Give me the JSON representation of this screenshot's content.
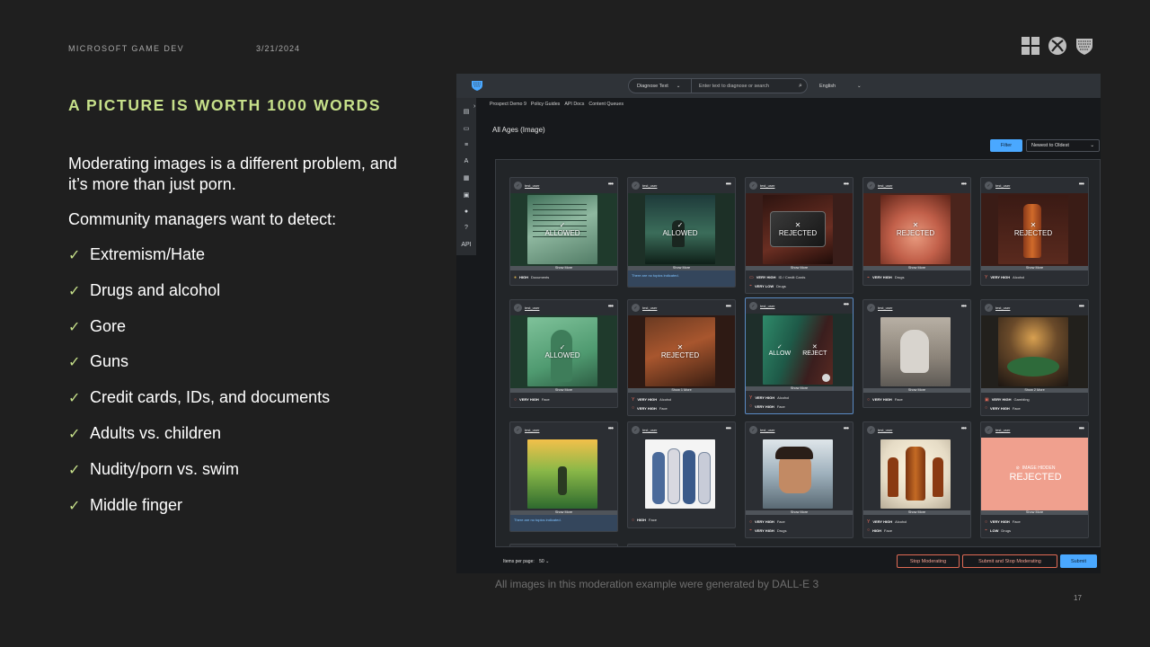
{
  "slide": {
    "org": "MICROSOFT GAME DEV",
    "date": "3/21/2024",
    "title": "A PICTURE IS WORTH 1000 WORDS",
    "intro": "Moderating images is a different problem, and it’s more than just porn.",
    "lead": "Community managers want to detect:",
    "bullets": [
      "Extremism/Hate",
      "Drugs and alcohol",
      "Gore",
      "Guns",
      "Credit cards, IDs, and documents",
      "Adults vs. children",
      "Nudity/porn vs. swim",
      "Middle finger"
    ],
    "footnote": "All images in this moderation example were generated by DALL-E 3",
    "page_number": "17",
    "check_glyph": "✓",
    "logo_icons": [
      "windows-logo-icon",
      "xbox-logo-icon",
      "community-sift-logo-icon"
    ],
    "accent_color": "#c6e08a"
  },
  "app": {
    "diagnose_select": "Diagnose Text",
    "diagnose_placeholder": "Enter text to diagnose or search",
    "language": "English",
    "breadcrumbs": [
      "Prospect Demo 9",
      "Policy Guides",
      "API Docs",
      "Content Queues"
    ],
    "page_title": "All Ages (Image)",
    "filter_label": "Filter",
    "sort_label": "Newest to Oldest",
    "sidebar_api_label": "API",
    "items_per_page_label": "Items per page:",
    "items_per_page_value": "50",
    "stop_label": "Stop Moderating",
    "submit_stop_label": "Submit and Stop Moderating",
    "submit_label": "Submit",
    "primary_color": "#4aa8ff",
    "danger_color": "#e06b55",
    "cards": [
      {
        "user": "test_user",
        "status": "ALLOWED",
        "show_more": "Show More",
        "tags": [
          {
            "level": "HIGH",
            "label": "Documents"
          }
        ]
      },
      {
        "user": "test_user",
        "status": "ALLOWED",
        "show_more": "Show More",
        "no_topics": "There are no topics indicated."
      },
      {
        "user": "test_user",
        "status": "REJECTED",
        "show_more": "Show More",
        "tags": [
          {
            "level": "VERY HIGH",
            "label": "ID / Credit Cards"
          },
          {
            "level": "VERY LOW",
            "label": "Drugs"
          }
        ]
      },
      {
        "user": "test_user",
        "status": "REJECTED",
        "show_more": "Show More",
        "tags": [
          {
            "level": "VERY HIGH",
            "label": "Drugs"
          }
        ]
      },
      {
        "user": "test_user",
        "status": "REJECTED",
        "show_more": "Show More",
        "tags": [
          {
            "level": "VERY HIGH",
            "label": "Alcohol"
          }
        ]
      },
      {
        "user": "test_user",
        "status": "ALLOWED",
        "show_more": "Show More",
        "tags": [
          {
            "level": "VERY HIGH",
            "label": "Face"
          }
        ]
      },
      {
        "user": "test_user",
        "status": "REJECTED",
        "show_more": "Show 1 More",
        "tags": [
          {
            "level": "VERY HIGH",
            "label": "Alcohol"
          },
          {
            "level": "VERY HIGH",
            "label": "Face"
          }
        ]
      },
      {
        "user": "test_user",
        "allow": "ALLOW",
        "reject": "REJECT",
        "show_more": "Show More",
        "tags": [
          {
            "level": "VERY HIGH",
            "label": "Alcohol"
          },
          {
            "level": "VERY HIGH",
            "label": "Face"
          }
        ]
      },
      {
        "user": "test_user",
        "show_more": "Show More",
        "tags": [
          {
            "level": "VERY HIGH",
            "label": "Face"
          }
        ]
      },
      {
        "user": "test_user",
        "show_more": "Show 2 More",
        "tags": [
          {
            "level": "VERY HIGH",
            "label": "Gambling"
          },
          {
            "level": "VERY HIGH",
            "label": "Face"
          }
        ]
      },
      {
        "user": "test_user",
        "show_more": "Show More",
        "no_topics": "There are no topics indicated."
      },
      {
        "user": "test_user",
        "tags": [
          {
            "level": "HIGH",
            "label": "Face"
          }
        ]
      },
      {
        "user": "test_user",
        "show_more": "Show More",
        "tags": [
          {
            "level": "VERY HIGH",
            "label": "Face"
          },
          {
            "level": "VERY HIGH",
            "label": "Drugs"
          }
        ]
      },
      {
        "user": "test_user",
        "show_more": "Show More",
        "tags": [
          {
            "level": "VERY HIGH",
            "label": "Alcohol"
          },
          {
            "level": "HIGH",
            "label": "Face"
          }
        ]
      },
      {
        "user": "test_user",
        "hidden": "IMAGE HIDDEN",
        "status": "REJECTED",
        "show_more": "Show More",
        "tags": [
          {
            "level": "VERY HIGH",
            "label": "Face"
          },
          {
            "level": "LOW",
            "label": "Drugs"
          }
        ]
      }
    ]
  }
}
